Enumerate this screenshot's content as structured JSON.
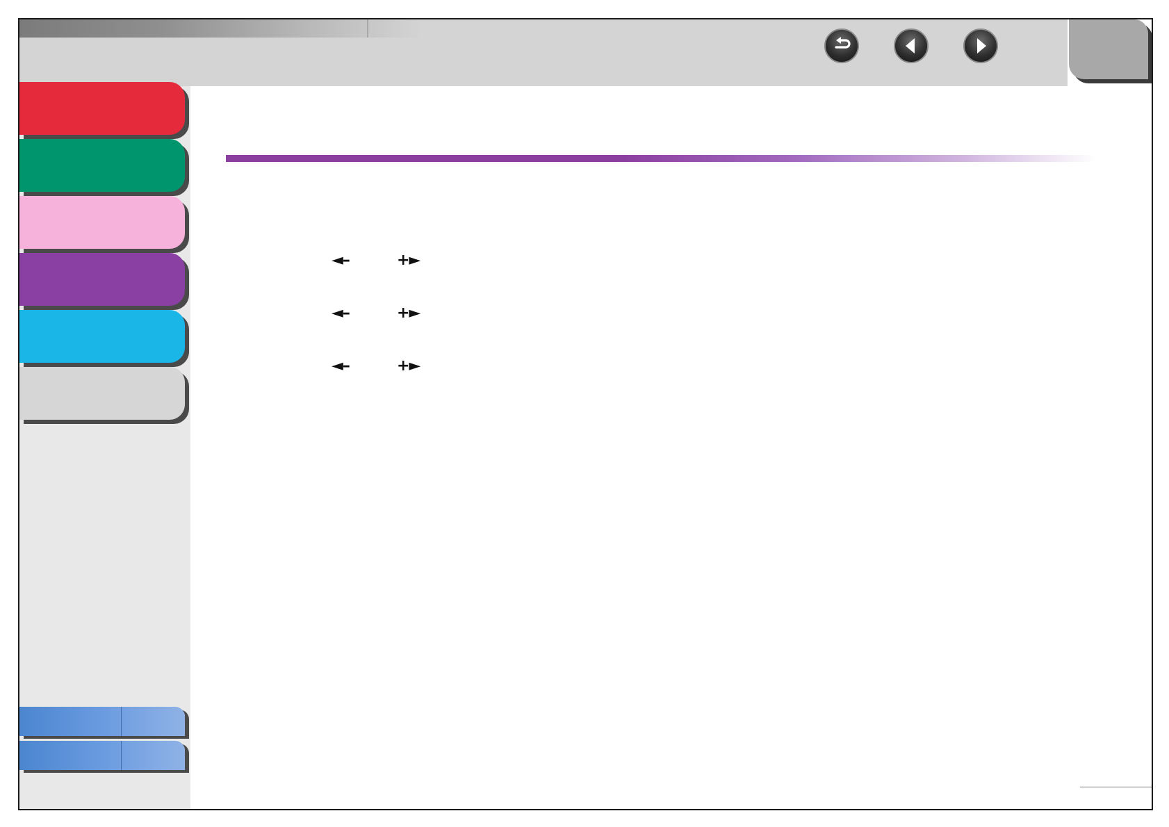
{
  "colors": {
    "topbar": "#d4d4d4",
    "sidebar": "#e8e8e8",
    "accent_rule": "#8a3f9f",
    "tab_red": "#e52a3c",
    "tab_green": "#00956c",
    "tab_pink": "#f7b2db",
    "tab_purple": "#8a3fa3",
    "tab_cyan": "#1ab6e8",
    "tab_gray": "#d6d6d6",
    "tab_blue": "#4b86cf"
  },
  "nav": {
    "back_icon": "return-arrow-icon",
    "prev_icon": "left-triangle-icon",
    "next_icon": "right-triangle-icon"
  },
  "sidebar": {
    "tabs": [
      {
        "name": "red",
        "color": "#e52a3c"
      },
      {
        "name": "green",
        "color": "#00956c"
      },
      {
        "name": "pink",
        "color": "#f7b2db"
      },
      {
        "name": "purple",
        "color": "#8a3fa3"
      },
      {
        "name": "cyan",
        "color": "#1ab6e8"
      },
      {
        "name": "gray",
        "color": "#d6d6d6"
      }
    ]
  },
  "adjust_keys": [
    {
      "minus": "◄–",
      "plus": "+►"
    },
    {
      "minus": "◄–",
      "plus": "+►"
    },
    {
      "minus": "◄–",
      "plus": "+►"
    }
  ]
}
